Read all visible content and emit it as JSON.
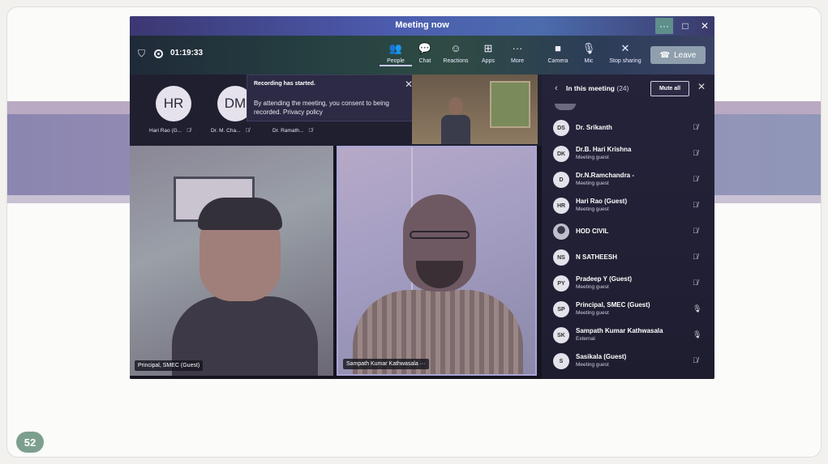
{
  "slide": {
    "page_number": "52"
  },
  "window": {
    "title": "Meeting now",
    "controls": {
      "more": "···",
      "maximize": "□",
      "close": "✕"
    }
  },
  "toolbar": {
    "timer": "01:19:33",
    "buttons": [
      {
        "label": "People",
        "icon": "👥"
      },
      {
        "label": "Chat",
        "icon": "💬"
      },
      {
        "label": "Reactions",
        "icon": "☺"
      },
      {
        "label": "Apps",
        "icon": "⊞"
      },
      {
        "label": "More",
        "icon": "···"
      },
      {
        "label": "Camera",
        "icon": "■"
      },
      {
        "label": "Mic",
        "icon": "🎙"
      },
      {
        "label": "Stop sharing",
        "icon": "✕"
      }
    ],
    "leave_label": "Leave"
  },
  "stage": {
    "avatars": [
      {
        "initials": "HR",
        "label": "Hari Rao (G..."
      },
      {
        "initials": "DM",
        "label": "Dr. M. Cha..."
      },
      {
        "initials": "",
        "label": "Dr. Ramath..."
      }
    ],
    "toast": {
      "title": "Recording has started.",
      "body": "By attending the meeting, you consent to being recorded. Privacy policy"
    },
    "tiles": [
      {
        "name": "Principal, SMEC (Guest)"
      },
      {
        "name": "Sampath Kumar Kathwasala ···"
      }
    ]
  },
  "people_panel": {
    "title": "In this meeting",
    "count": "(24)",
    "mute_all_label": "Mute all",
    "participants": [
      {
        "initials": "DS",
        "name": "Dr. Srikanth",
        "sub": "",
        "mic": "muted"
      },
      {
        "initials": "DK",
        "name": "Dr.B. Hari Krishna",
        "sub": "Meeting guest",
        "mic": "muted"
      },
      {
        "initials": "D",
        "name": "Dr.N.Ramchandra -",
        "sub": "Meeting guest",
        "mic": "muted"
      },
      {
        "initials": "HR",
        "name": "Hari Rao (Guest)",
        "sub": "Meeting guest",
        "mic": "muted"
      },
      {
        "initials": "",
        "name": "HOD CIVIL",
        "sub": "",
        "mic": "muted"
      },
      {
        "initials": "NS",
        "name": "N SATHEESH",
        "sub": "",
        "mic": "muted"
      },
      {
        "initials": "PY",
        "name": "Pradeep Y (Guest)",
        "sub": "Meeting guest",
        "mic": "muted"
      },
      {
        "initials": "SP",
        "name": "Principal, SMEC (Guest)",
        "sub": "Meeting guest",
        "mic": "on"
      },
      {
        "initials": "SK",
        "name": "Sampath Kumar Kathwasala",
        "sub": "External",
        "mic": "on"
      },
      {
        "initials": "S",
        "name": "Sasikala (Guest)",
        "sub": "Meeting guest",
        "mic": "muted"
      }
    ]
  }
}
